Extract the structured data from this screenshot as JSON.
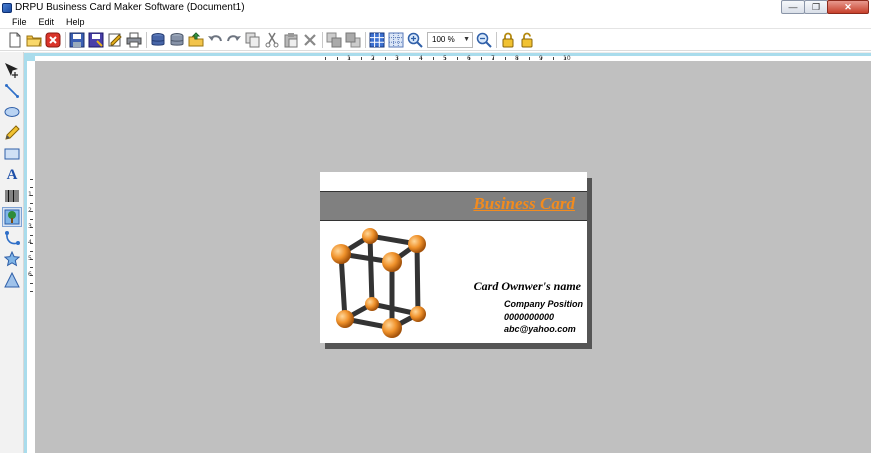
{
  "window": {
    "title": "DRPU Business Card Maker Software  (Document1)",
    "minimize_glyph": "—",
    "maximize_glyph": "❐",
    "close_glyph": "✕"
  },
  "menu": {
    "items": [
      {
        "label": "File"
      },
      {
        "label": "Edit"
      },
      {
        "label": "Help"
      }
    ]
  },
  "toolbar": {
    "zoom_value": "100 %",
    "zoom_arrow": "▼",
    "icons": [
      "new-document-icon",
      "open-folder-icon",
      "close-document-icon",
      "save-icon",
      "save-as-icon",
      "edit-properties-icon",
      "print-icon",
      "database-import-icon",
      "database-icon",
      "open-file-icon",
      "undo-icon",
      "redo-icon",
      "copy-icon",
      "cut-icon",
      "paste-icon",
      "delete-icon",
      "bring-front-icon",
      "send-back-icon",
      "grid-icon",
      "snap-grid-icon",
      "zoom-in-icon",
      "zoom-out-icon",
      "lock-icon",
      "unlock-icon"
    ]
  },
  "tools": {
    "icons": [
      "pointer-move-icon",
      "line-tool-icon",
      "ellipse-tool-icon",
      "pencil-tool-icon",
      "rectangle-tool-icon",
      "text-tool-icon",
      "barcode-tool-icon",
      "image-tool-icon",
      "curve-tool-icon",
      "star-tool-icon",
      "triangle-tool-icon"
    ],
    "text_tool_glyph": "A"
  },
  "ruler": {
    "h_labels": [
      "1",
      "2",
      "3",
      "4",
      "5",
      "6",
      "7",
      "8",
      "9",
      "10"
    ],
    "v_labels": [
      "1",
      "2",
      "3",
      "4",
      "5",
      "6"
    ]
  },
  "card": {
    "title": "Business Card",
    "name": "Card Ownwer's name",
    "position": "Company Position",
    "phone": "0000000000",
    "email": "abc@yahoo.com",
    "colors": {
      "band": "#808080",
      "title": "#f28b1e",
      "canvas": "#c0c0c0",
      "ruler_accent": "#a9dcec"
    }
  }
}
